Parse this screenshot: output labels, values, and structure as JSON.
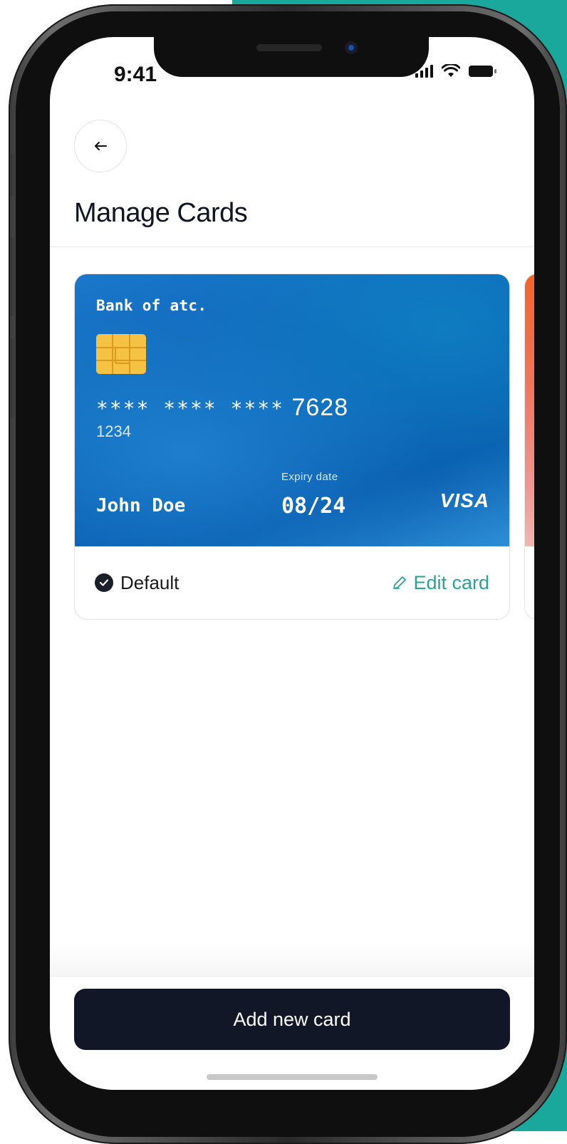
{
  "status_bar": {
    "time": "9:41"
  },
  "header": {
    "title": "Manage Cards"
  },
  "card": {
    "bank": "Bank of atc.",
    "number_masked": "**** **** ****",
    "number_last4": "7628",
    "sub_number": "1234",
    "expiry_label": "Expiry date",
    "expiry": "08/24",
    "holder": "John Doe",
    "brand": "VISA",
    "default_label": "Default",
    "edit_label": "Edit card"
  },
  "footer": {
    "add_button_label": "Add new card"
  },
  "colors": {
    "accent": "#27a592",
    "button": "#121727",
    "teal_bg": "#1aa89c",
    "card_blue": "#0b63b6"
  }
}
